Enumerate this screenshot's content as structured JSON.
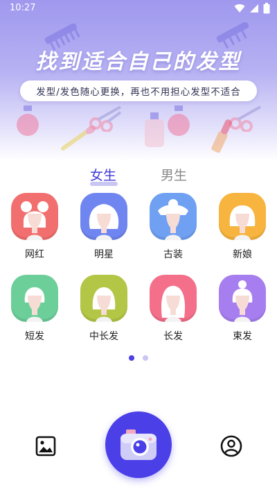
{
  "status_bar": {
    "time": "10:27"
  },
  "hero": {
    "title": "找到适合自己的发型",
    "subtitle": "发型/发色随心更换，再也不用担心发型不适合"
  },
  "tabs": [
    {
      "label": "女生",
      "active": true
    },
    {
      "label": "男生",
      "active": false
    }
  ],
  "styles": [
    {
      "label": "网红",
      "color": "#f26f6f",
      "hair": "buns"
    },
    {
      "label": "明星",
      "color": "#6f85f0",
      "hair": "curly"
    },
    {
      "label": "古装",
      "color": "#6fa0f2",
      "hair": "updo"
    },
    {
      "label": "新娘",
      "color": "#f7b43e",
      "hair": "bob"
    },
    {
      "label": "短发",
      "color": "#6ccf9a",
      "hair": "short"
    },
    {
      "label": "中长发",
      "color": "#b3c645",
      "hair": "medium"
    },
    {
      "label": "长发",
      "color": "#f46f8a",
      "hair": "long"
    },
    {
      "label": "束发",
      "color": "#a77ef0",
      "hair": "topknot"
    }
  ],
  "pager": {
    "pages": 2,
    "active_index": 0,
    "active_color": "#4b40e8",
    "inactive_color": "#c9c6f4"
  },
  "bottom_nav": {
    "gallery_icon": "image-icon",
    "camera_icon": "camera-icon",
    "profile_icon": "profile-icon"
  }
}
